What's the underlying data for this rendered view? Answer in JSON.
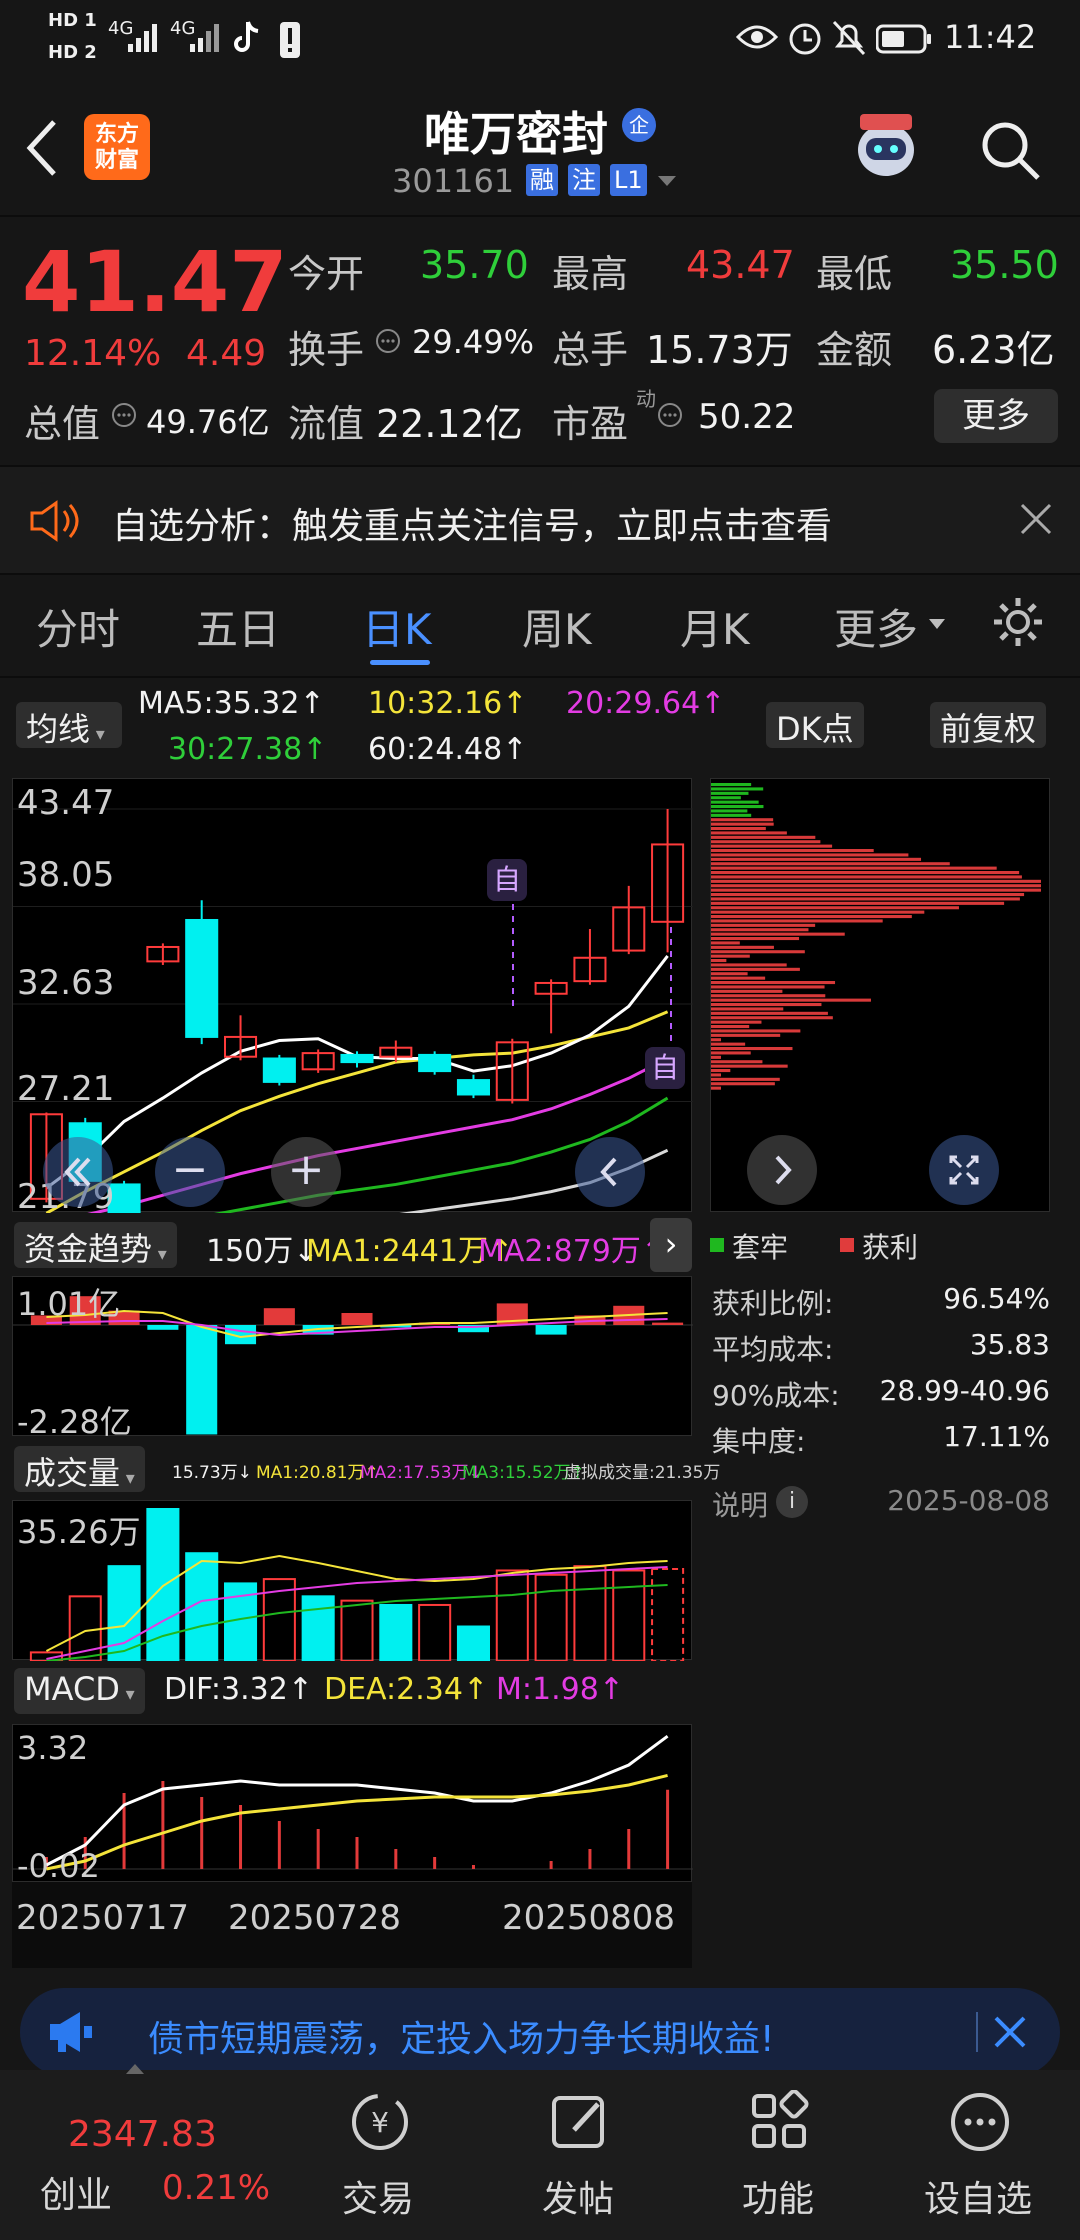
{
  "status_bar": {
    "sim1": "HD 1",
    "sim2": "HD 2",
    "net1": "4G",
    "net2": "4G",
    "time": "11:42"
  },
  "header": {
    "brand_line1": "东方",
    "brand_line2": "财富",
    "stock_name": "唯万密封",
    "name_badge": "企",
    "stock_code": "301161",
    "tags": [
      "融",
      "注",
      "L1"
    ]
  },
  "quote": {
    "price": "41.47",
    "change_pct": "12.14%",
    "change_amt": "4.49",
    "open_label": "今开",
    "open": "35.70",
    "high_label": "最高",
    "high": "43.47",
    "low_label": "最低",
    "low": "35.50",
    "turnover_label": "换手",
    "turnover": "29.49%",
    "volume_label": "总手",
    "volume": "15.73万",
    "amount_label": "金额",
    "amount": "6.23亿",
    "mktcap_label": "总值",
    "mktcap": "49.76亿",
    "float_label": "流值",
    "float_cap": "22.12亿",
    "pe_label": "市盈",
    "pe_sup": "动",
    "pe": "50.22",
    "more_button": "更多"
  },
  "alert": {
    "text": "自选分析：触发重点关注信号，立即点击查看"
  },
  "tabs": [
    "分时",
    "五日",
    "日K",
    "周K",
    "月K",
    "更多"
  ],
  "active_tab": "日K",
  "ma_bar": {
    "selector": "均线",
    "ma5": "MA5:35.32↑",
    "ma10": "10:32.16↑",
    "ma20": "20:29.64↑",
    "ma30": "30:27.38↑",
    "ma60": "60:24.48↑",
    "dk_button": "DK点",
    "adjust_button": "前复权"
  },
  "kline": {
    "y_labels": [
      "43.47",
      "38.05",
      "32.63",
      "27.21",
      "21.79"
    ],
    "marker": "自",
    "colors": {
      "up": "#ff3b3b",
      "down": "#00f0f0",
      "ma5": "#ffffff",
      "ma10": "#f4e43a",
      "ma20": "#e33ce3",
      "ma30": "#1fb81f",
      "ma60": "#d8d8d8"
    },
    "candles": [
      {
        "o": 21.8,
        "c": 26.5,
        "h": 26.6,
        "l": 21.6
      },
      {
        "o": 26.0,
        "c": 22.8,
        "h": 26.3,
        "l": 22.5
      },
      {
        "o": 22.6,
        "c": 20.2,
        "h": 22.8,
        "l": 20.0
      },
      {
        "o": 35.0,
        "c": 35.8,
        "h": 36.0,
        "l": 34.8
      },
      {
        "o": 37.3,
        "c": 30.8,
        "h": 38.4,
        "l": 30.4
      },
      {
        "o": 29.7,
        "c": 30.8,
        "h": 32.0,
        "l": 29.5
      },
      {
        "o": 29.6,
        "c": 28.3,
        "h": 29.8,
        "l": 28.1
      },
      {
        "o": 29.0,
        "c": 29.9,
        "h": 30.1,
        "l": 28.8
      },
      {
        "o": 29.8,
        "c": 29.4,
        "h": 30.0,
        "l": 29.1
      },
      {
        "o": 29.7,
        "c": 30.2,
        "h": 30.6,
        "l": 29.4
      },
      {
        "o": 29.8,
        "c": 28.9,
        "h": 30.0,
        "l": 28.7
      },
      {
        "o": 28.4,
        "c": 27.6,
        "h": 28.7,
        "l": 27.4
      },
      {
        "o": 27.3,
        "c": 30.5,
        "h": 30.7,
        "l": 27.1
      },
      {
        "o": 33.2,
        "c": 33.8,
        "h": 34.0,
        "l": 31.0
      },
      {
        "o": 33.9,
        "c": 35.2,
        "h": 36.8,
        "l": 33.7
      },
      {
        "o": 35.6,
        "c": 38.0,
        "h": 39.2,
        "l": 35.4
      },
      {
        "o": 37.2,
        "c": 41.5,
        "h": 43.47,
        "l": 35.5
      }
    ],
    "ma_lines": {
      "ma5": [
        22.4,
        24.0,
        26.1,
        27.4,
        28.8,
        30.0,
        30.6,
        30.7,
        29.7,
        29.6,
        29.6,
        28.9,
        29.2,
        29.9,
        30.9,
        32.5,
        35.3
      ],
      "ma10": [
        21.0,
        22.2,
        23.3,
        24.4,
        25.6,
        26.7,
        27.5,
        28.2,
        28.8,
        29.4,
        29.6,
        29.8,
        29.9,
        30.3,
        30.8,
        31.3,
        32.2
      ],
      "ma20": [
        20.4,
        20.9,
        21.4,
        22.0,
        22.6,
        23.2,
        23.7,
        24.2,
        24.6,
        25.0,
        25.4,
        25.8,
        26.2,
        26.8,
        27.6,
        28.5,
        29.6
      ],
      "ma30": [
        19.4,
        19.7,
        20.0,
        20.4,
        20.8,
        21.2,
        21.6,
        22.0,
        22.3,
        22.6,
        23.0,
        23.4,
        23.8,
        24.4,
        25.1,
        26.1,
        27.4
      ],
      "ma60": [
        18.8,
        19.1,
        19.3,
        19.5,
        19.7,
        19.9,
        20.1,
        20.4,
        20.6,
        20.9,
        21.2,
        21.5,
        21.8,
        22.2,
        22.7,
        23.5,
        24.5
      ]
    }
  },
  "chip": {
    "legend_trapped": "套牢",
    "legend_profit": "获利",
    "rows": [
      {
        "label": "获利比例:",
        "value": "96.54%"
      },
      {
        "label": "平均成本:",
        "value": "35.83"
      },
      {
        "label": "90%成本:",
        "value": "28.99-40.96"
      },
      {
        "label": "集中度:",
        "value": "17.11%"
      }
    ],
    "note_label": "说明",
    "date": "2025-08-08"
  },
  "fund_trend": {
    "selector": "资金趋势",
    "value": "150万↓",
    "ma1": "MA1:2441万↑",
    "ma2": "MA2:879万↑",
    "y_top": "1.01亿",
    "y_bottom": "-2.28亿",
    "bars": [
      0.2,
      0.6,
      0.3,
      -0.1,
      -2.28,
      -0.4,
      0.35,
      -0.2,
      0.25,
      -0.05,
      0.05,
      -0.15,
      0.45,
      -0.2,
      0.2,
      0.4,
      0.05
    ]
  },
  "volume": {
    "selector": "成交量",
    "legend": "15.73万↓",
    "ma1": "MA1:20.81万↑",
    "ma2": "MA2:17.53万↓",
    "ma3": "MA3:15.52万↑",
    "virtual": "虚拟成交量:21.35万",
    "y_top": "35.26万",
    "bars": [
      2.0,
      15.0,
      22.0,
      35.26,
      25.0,
      18.0,
      19.0,
      15.0,
      14.0,
      13.0,
      13.0,
      8.0,
      21.0,
      20.0,
      22.0,
      21.0,
      21.35
    ],
    "up": [
      true,
      true,
      false,
      false,
      false,
      false,
      true,
      false,
      true,
      false,
      true,
      false,
      true,
      true,
      true,
      true,
      true
    ]
  },
  "macd": {
    "selector": "MACD",
    "dif": "DIF:3.32↑",
    "dea": "DEA:2.34↑",
    "m": "M:1.98↑",
    "y_top": "3.32",
    "y_bottom": "-0.02",
    "x_labels": [
      "20250717",
      "20250728",
      "20250808"
    ],
    "dif_line": [
      0.1,
      0.6,
      1.6,
      2.0,
      2.1,
      2.2,
      2.1,
      2.1,
      2.1,
      2.0,
      1.9,
      1.7,
      1.7,
      1.9,
      2.2,
      2.6,
      3.32
    ],
    "dea_line": [
      0.0,
      0.2,
      0.6,
      0.9,
      1.2,
      1.4,
      1.5,
      1.6,
      1.7,
      1.75,
      1.8,
      1.8,
      1.8,
      1.85,
      1.95,
      2.1,
      2.34
    ],
    "m_bars": [
      0.3,
      0.8,
      1.9,
      2.2,
      1.8,
      1.6,
      1.2,
      1.0,
      0.8,
      0.5,
      0.3,
      0.1,
      0.0,
      0.2,
      0.5,
      1.0,
      1.98
    ]
  },
  "banner": {
    "text": "债市短期震荡，定投入场力争长期收益!"
  },
  "bottom_nav": {
    "index_value": "2347.83",
    "index_name": "创业",
    "index_change": "0.21%",
    "items": [
      "交易",
      "发帖",
      "功能",
      "设自选"
    ]
  }
}
